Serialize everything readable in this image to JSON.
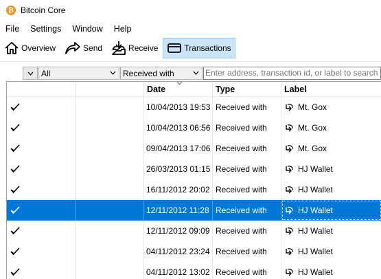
{
  "window": {
    "title": "Bitcoin Core",
    "logo_icon": "bitcoin-logo-icon",
    "logo_glyph": "₿",
    "logo_color": "#f7931a"
  },
  "menu": [
    "File",
    "Settings",
    "Window",
    "Help"
  ],
  "toolbar": [
    {
      "label": "Overview",
      "icon": "home-icon",
      "active": false
    },
    {
      "label": "Send",
      "icon": "send-arrow-icon",
      "active": false
    },
    {
      "label": "Receive",
      "icon": "receive-inbox-icon",
      "active": false
    },
    {
      "label": "Transactions",
      "icon": "transactions-card-icon",
      "active": true
    }
  ],
  "filters": {
    "date": "All",
    "type": "Received with",
    "search_placeholder": "Enter address, transaction id, or label to search"
  },
  "table": {
    "columns": [
      "",
      "",
      "Date",
      "Type",
      "Label"
    ],
    "sort_column": "Date",
    "selected_color": "#0078d7",
    "rows": [
      {
        "date": "10/04/2013 19:53",
        "type": "Received with",
        "label": "Mt. Gox"
      },
      {
        "date": "10/04/2013 06:56",
        "type": "Received with",
        "label": "Mt. Gox"
      },
      {
        "date": "09/04/2013 17:06",
        "type": "Received with",
        "label": "Mt. Gox"
      },
      {
        "date": "26/03/2013 01:15",
        "type": "Received with",
        "label": "HJ Wallet"
      },
      {
        "date": "16/11/2012 20:02",
        "type": "Received with",
        "label": "HJ Wallet"
      },
      {
        "date": "12/11/2012 11:28",
        "type": "Received with",
        "label": "HJ Wallet",
        "selected": true
      },
      {
        "date": "12/11/2012 09:09",
        "type": "Received with",
        "label": "HJ Wallet"
      },
      {
        "date": "04/11/2012 23:24",
        "type": "Received with",
        "label": "HJ Wallet"
      },
      {
        "date": "04/11/2012 13:02",
        "type": "Received with",
        "label": "HJ Wallet"
      }
    ]
  }
}
